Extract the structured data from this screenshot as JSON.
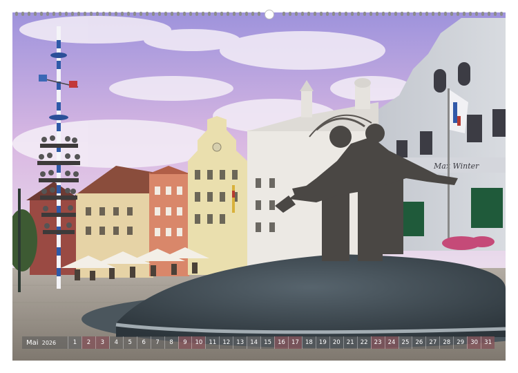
{
  "calendar": {
    "month": "Mai",
    "year": "2026",
    "days": [
      "1",
      "2",
      "3",
      "4",
      "5",
      "6",
      "7",
      "8",
      "9",
      "10",
      "11",
      "12",
      "13",
      "14",
      "15",
      "16",
      "17",
      "18",
      "19",
      "20",
      "21",
      "22",
      "23",
      "24",
      "25",
      "26",
      "27",
      "28",
      "29",
      "30",
      "31"
    ],
    "weekend_days": [
      "2",
      "3",
      "9",
      "10",
      "16",
      "17",
      "23",
      "24",
      "30",
      "31"
    ],
    "holiday_days": [
      "1",
      "14",
      "25"
    ]
  },
  "photo": {
    "subject": "town-square-with-maypole-and-bronze-fountain",
    "shop_sign": "Max Winter",
    "colors": {
      "sky_top": "#b7a7e0",
      "sky_pink": "#e6c3e3",
      "clouds": "#f3eef6",
      "house_yellow": "#e9dca9",
      "house_salmon": "#d98a6c",
      "house_white": "#ece9e4",
      "house_grey": "#c9ccd1",
      "bronze": "#4a4744",
      "water": "#3d4a52",
      "cobblestone": "#9c958c"
    }
  }
}
